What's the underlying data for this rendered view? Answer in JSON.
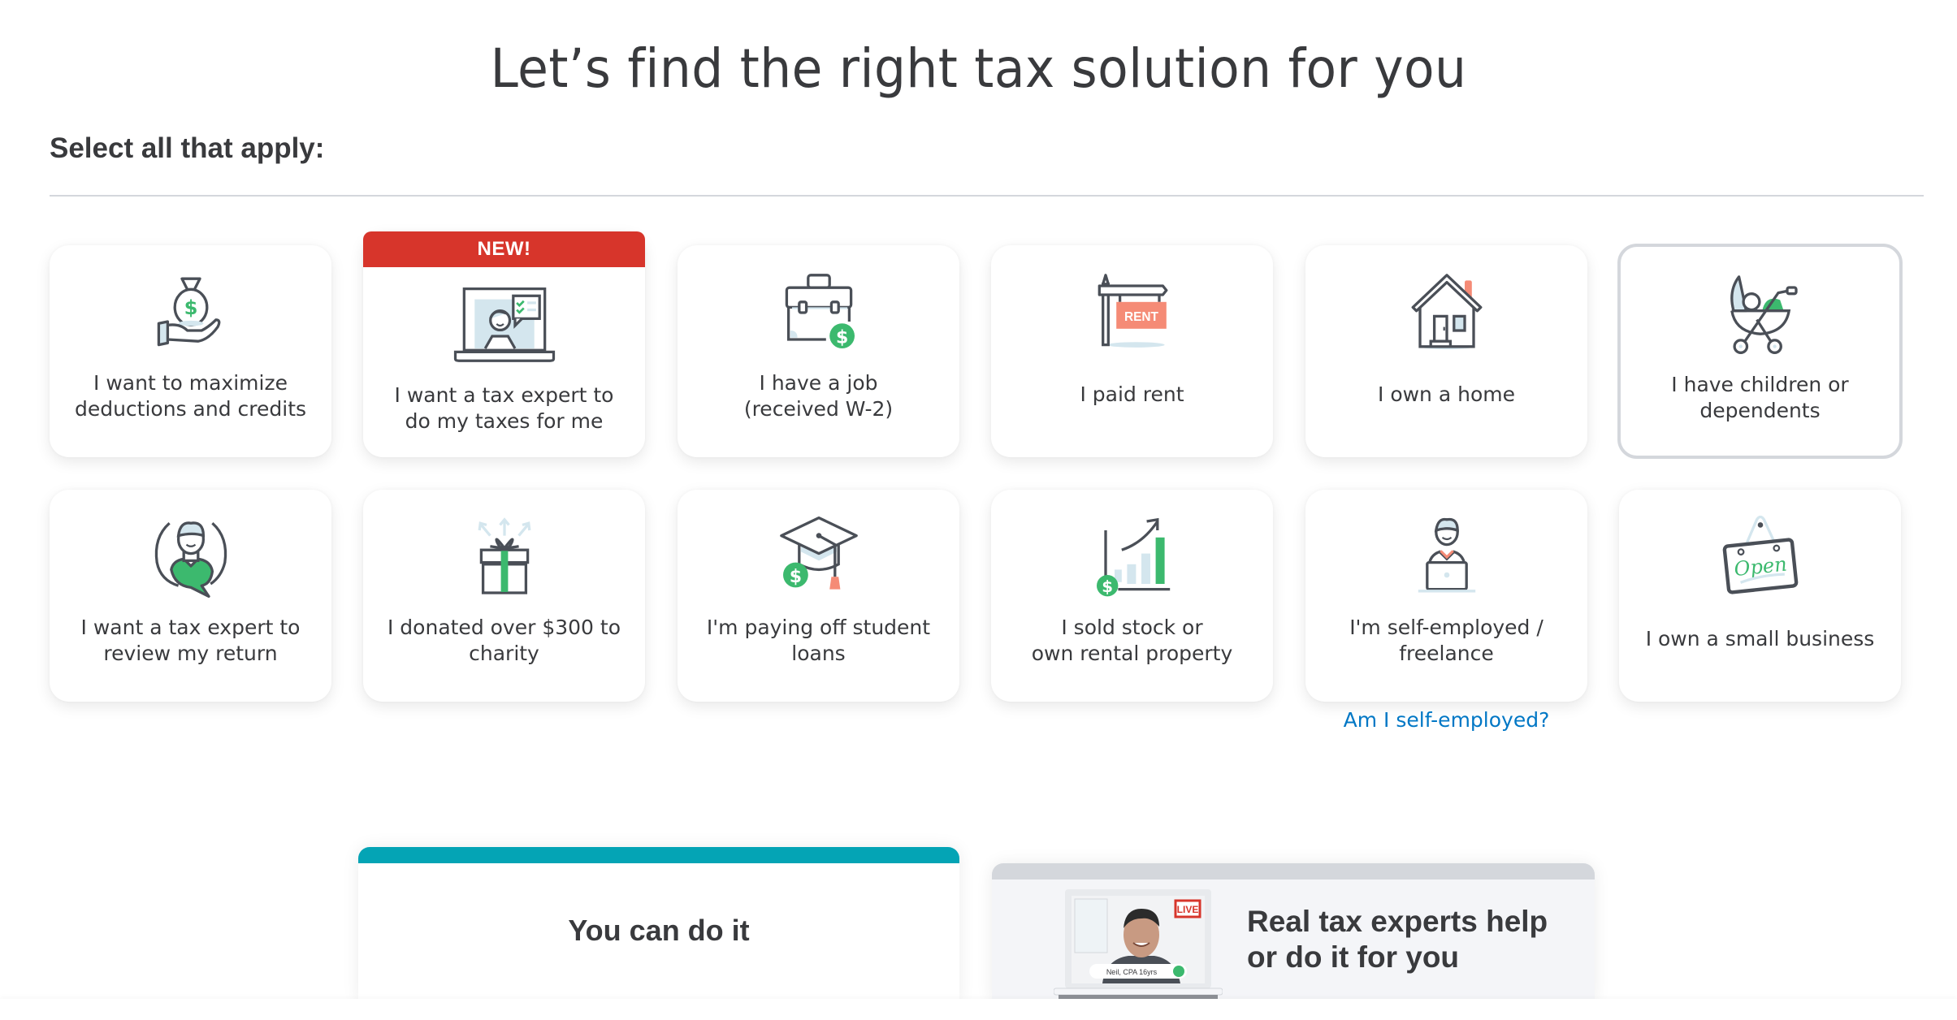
{
  "header": {
    "title": "Let’s find the right tax solution for you",
    "instruction": "Select all that apply:"
  },
  "colors": {
    "text": "#393a3d",
    "banner_red": "#d7352b",
    "link_blue": "#0077c5",
    "accent_green": "#3cb96e",
    "accent_teal": "#04a4b5",
    "rent_salmon": "#f58b76",
    "icon_light_blue": "#d4e6ee"
  },
  "options": [
    {
      "label": "I want to maximize\ndeductions and credits",
      "icon": "money-bag-hand-icon",
      "selected": false
    },
    {
      "label": "I want a tax expert to\ndo my taxes for me",
      "icon": "laptop-expert-icon",
      "banner": "NEW!",
      "selected": false
    },
    {
      "label": "I have a job\n(received W-2)",
      "icon": "briefcase-dollar-icon",
      "selected": false
    },
    {
      "label": "I paid rent",
      "icon": "rent-sign-icon",
      "icon_text": "RENT",
      "selected": false
    },
    {
      "label": "I own a home",
      "icon": "house-icon",
      "selected": false
    },
    {
      "label": "I have children or\ndependents",
      "icon": "stroller-icon",
      "selected": true
    },
    {
      "label": "I want a tax expert to\nreview my return",
      "icon": "expert-chat-icon",
      "selected": false
    },
    {
      "label": "I donated over $300 to\ncharity",
      "icon": "gift-icon",
      "selected": false
    },
    {
      "label": "I'm paying off student\nloans",
      "icon": "graduation-cap-dollar-icon",
      "selected": false
    },
    {
      "label": "I sold stock or\nown rental property",
      "icon": "growth-chart-icon",
      "selected": false
    },
    {
      "label": "I'm self-employed /\nfreelance",
      "icon": "freelancer-laptop-icon",
      "selected": false
    },
    {
      "label": "I own a small business",
      "icon": "open-sign-icon",
      "icon_text": "Open",
      "selected": false
    }
  ],
  "help_link": "Am I self-employed?",
  "products": {
    "diy": {
      "title": "You can do it"
    },
    "expert": {
      "title_line1": "Real tax experts help",
      "title_line2": "or do it for you",
      "live_badge": "LIVE",
      "expert_name": "Neil, CPA 16yrs"
    }
  }
}
